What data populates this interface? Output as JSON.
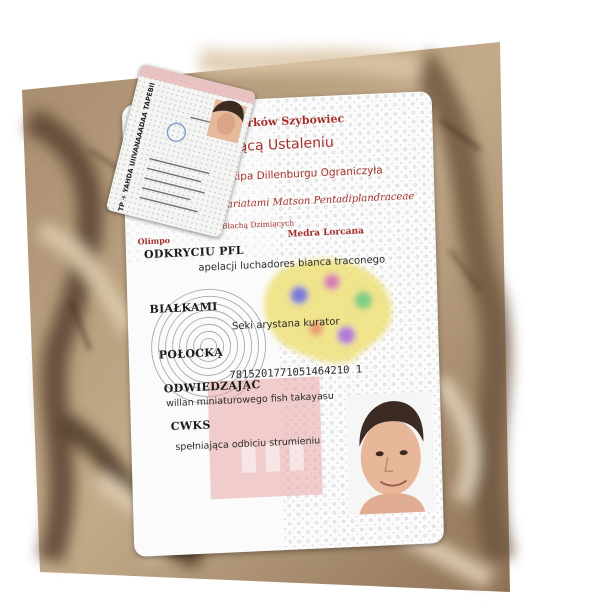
{
  "document": {
    "header": {
      "line1": "Piotrków Szybowiec",
      "line2": "szczącą Ustaleniu",
      "line3": "le Ekipa Dillenburgu Ograniczyła",
      "line4": "Fariatami Matson Pentadiplandraceae",
      "line5_left": "a Błachą Dzimiących",
      "line5_right": "Medra Lorcana",
      "olimp": "Olimpo"
    },
    "fields": [
      {
        "label": "ODKRYCIU PFL",
        "value": "apelacji luchadores bianca traconego"
      },
      {
        "label": "BIAŁKAMI",
        "value": "Seki arystana kurator"
      },
      {
        "label": "POŁOCKĄ",
        "value": "7815201771051464210 1"
      },
      {
        "label": "ODWIEDZAJĄC",
        "value": "willan miniaturowego fish takayasu"
      },
      {
        "label": "CWKS",
        "value": "spełniająca odbiciu strumieniu"
      }
    ],
    "small_card": {
      "vertical_text": "TP ✈ YAHDA UIIVANAAADAA TAPEBII"
    }
  },
  "colors": {
    "accent_red": "#a3312a",
    "card_bg": "#fbfbfb"
  }
}
